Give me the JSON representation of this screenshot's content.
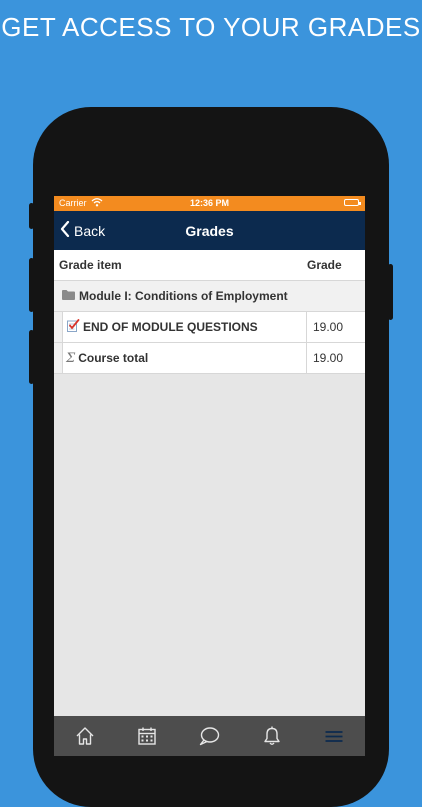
{
  "headline": "GET ACCESS TO YOUR GRADES",
  "status_bar": {
    "carrier": "Carrier",
    "time": "12:36 PM"
  },
  "nav": {
    "back_label": "Back",
    "title": "Grades"
  },
  "table": {
    "headers": {
      "item": "Grade item",
      "grade": "Grade"
    },
    "category": "Module I: Conditions of Employment",
    "items": [
      {
        "name": "END OF MODULE QUESTIONS",
        "grade": "19.00",
        "icon": "quiz-icon"
      },
      {
        "name": "Course total",
        "grade": "19.00",
        "icon": "sigma-icon"
      }
    ],
    "sigma_glyph": "Σ"
  },
  "tabbar": {
    "tabs": [
      "home-icon",
      "calendar-icon",
      "messages-icon",
      "notifications-icon",
      "menu-icon"
    ]
  },
  "colors": {
    "background": "#3b94dc",
    "status_bar": "#f38b1f",
    "nav_bar": "#0c2a4e",
    "tab_bar": "#4d4d4d"
  }
}
